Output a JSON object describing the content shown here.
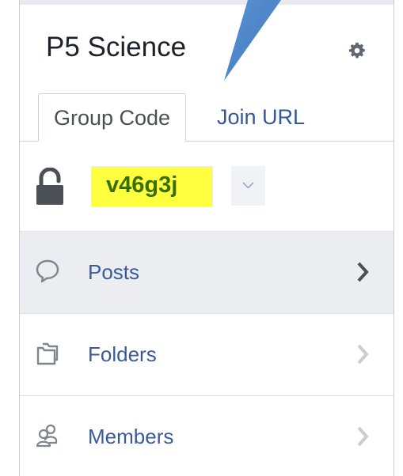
{
  "group": {
    "title": "P5 Science"
  },
  "tabs": [
    {
      "label": "Group Code",
      "active": true
    },
    {
      "label": "Join URL",
      "active": false
    }
  ],
  "code": {
    "value": "v46g3j",
    "highlight_color": "#ffff3d",
    "icon": "lock-icon"
  },
  "nav": [
    {
      "label": "Posts",
      "icon": "speech-bubble-icon",
      "active": true
    },
    {
      "label": "Folders",
      "icon": "folders-icon",
      "active": false
    },
    {
      "label": "Members",
      "icon": "members-icon",
      "active": false
    }
  ],
  "colors": {
    "link": "#3b5a9a",
    "pointer": "#4a83c6"
  }
}
